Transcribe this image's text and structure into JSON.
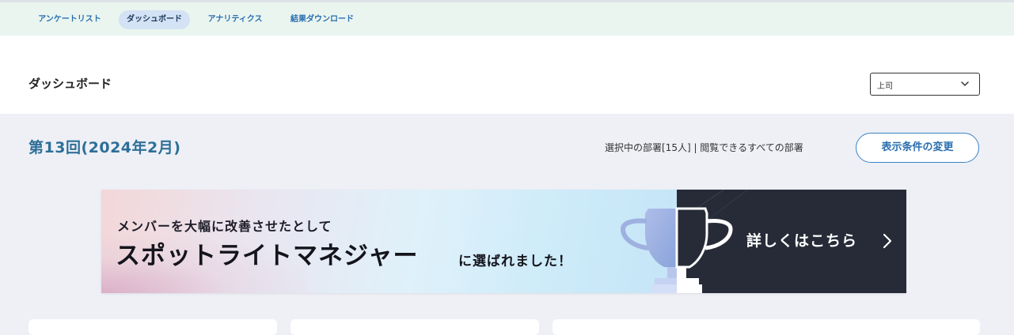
{
  "nav": {
    "tabs": [
      {
        "label": "アンケートリスト",
        "active": false
      },
      {
        "label": "ダッシュボード",
        "active": true
      },
      {
        "label": "アナリティクス",
        "active": false
      },
      {
        "label": "結果ダウンロード",
        "active": false
      }
    ]
  },
  "header": {
    "title": "ダッシュボード",
    "role_select": {
      "value": "上司"
    }
  },
  "summary": {
    "round_title": "第13回(2024年2月)",
    "dept_info": "選択中の部署[15人] | 閲覧できるすべての部署",
    "change_button": "表示条件の変更"
  },
  "banner": {
    "subtitle": "メンバーを大幅に改善させたとして",
    "main_title": "スポットライトマネジャー",
    "tail": "に選ばれました！",
    "detail_link": "詳しくはこちら",
    "trophy_icon": "trophy-icon"
  },
  "colors": {
    "accent": "#2a6fb0",
    "title_teal": "#2e6f97",
    "nav_bg": "#eaf5ef",
    "body_bg": "#eef0f6",
    "banner_dark": "#272b38"
  }
}
